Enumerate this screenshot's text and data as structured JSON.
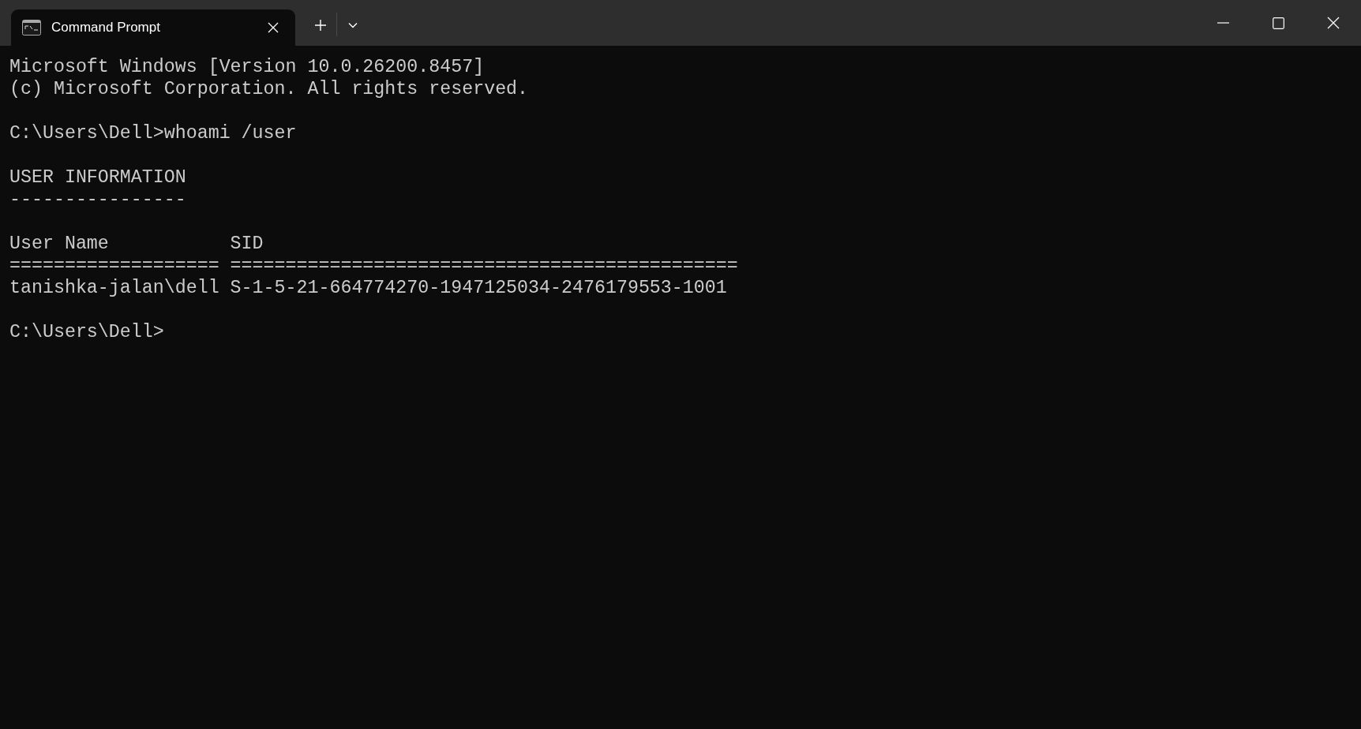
{
  "tabs": [
    {
      "title": "Command Prompt",
      "selected": true
    }
  ],
  "terminal": {
    "blocks": [
      [
        "Microsoft Windows [Version 10.0.26200.8457]",
        "(c) Microsoft Corporation. All rights reserved."
      ],
      [
        "C:\\Users\\Dell>whoami /user"
      ],
      [
        "USER INFORMATION",
        "----------------"
      ],
      [
        "User Name           SID",
        "=================== ==============================================",
        "tanishka-jalan\\dell S-1-5-21-664774270-1947125034-2476179553-1001"
      ],
      [
        "C:\\Users\\Dell>"
      ]
    ]
  }
}
